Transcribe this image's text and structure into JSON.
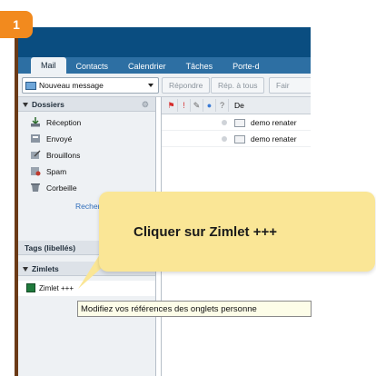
{
  "step": {
    "number": "1",
    "color": "#f28a1e"
  },
  "tabs": [
    {
      "label": "Mail",
      "active": true
    },
    {
      "label": "Contacts"
    },
    {
      "label": "Calendrier"
    },
    {
      "label": "Tâches"
    },
    {
      "label": "Porte-d"
    }
  ],
  "toolbar": {
    "new_message_label": "Nouveau message",
    "reply_label": "Répondre",
    "reply_all_label": "Rép. à tous",
    "forward_label": "Fair"
  },
  "sidebar": {
    "folders_header": "Dossiers",
    "folders": [
      {
        "label": "Réception",
        "icon": "inbox-icon"
      },
      {
        "label": "Envoyé",
        "icon": "sent-icon"
      },
      {
        "label": "Brouillons",
        "icon": "drafts-icon"
      },
      {
        "label": "Spam",
        "icon": "spam-icon"
      },
      {
        "label": "Corbeille",
        "icon": "trash-icon"
      }
    ],
    "search_label": "Recherch",
    "tags_header": "Tags (libellés)",
    "zimlets_header": "Zimlets",
    "zimlet_item": "Zimlet +++"
  },
  "message_list": {
    "from_header": "De",
    "rows": [
      {
        "sender": "demo renater"
      },
      {
        "sender": "demo renater"
      }
    ]
  },
  "tooltip": "Modifiez vos références des onglets personne",
  "callout": {
    "text": "Cliquer sur Zimlet +++"
  },
  "colors": {
    "topbar": "#2d6fa3",
    "callout": "#fae696",
    "accent_orange": "#f28a1e"
  }
}
